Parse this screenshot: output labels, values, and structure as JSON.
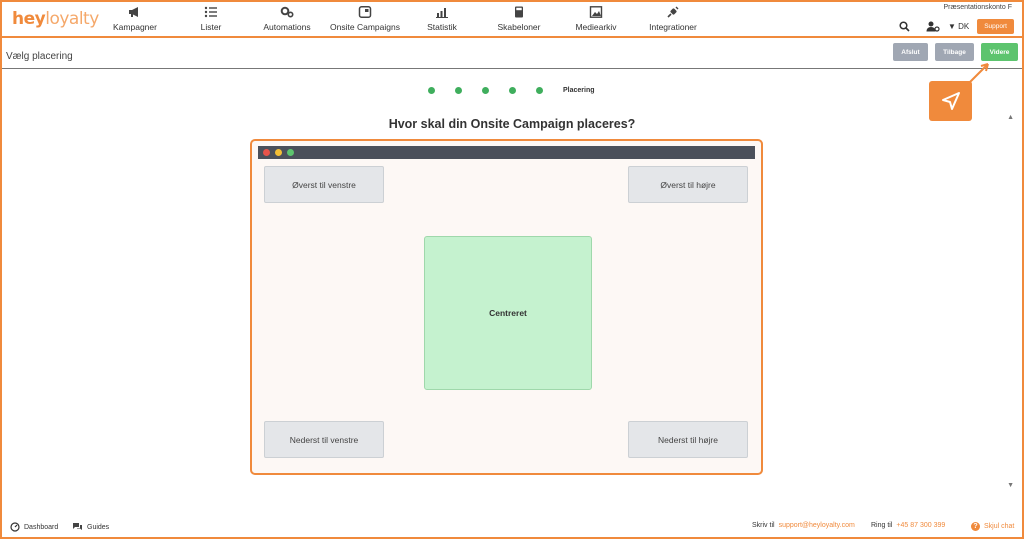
{
  "brand": {
    "logo_part1": "hey",
    "logo_part2": "loyalty"
  },
  "nav": {
    "items": [
      {
        "label": "Kampagner",
        "icon": "megaphone-icon"
      },
      {
        "label": "Lister",
        "icon": "list-icon"
      },
      {
        "label": "Automations",
        "icon": "gears-icon"
      },
      {
        "label": "Onsite Campaigns",
        "icon": "window-icon"
      },
      {
        "label": "Statistik",
        "icon": "chart-icon"
      },
      {
        "label": "Skabeloner",
        "icon": "calculator-icon"
      },
      {
        "label": "Mediearkiv",
        "icon": "image-icon"
      },
      {
        "label": "Integrationer",
        "icon": "plug-icon"
      }
    ],
    "account": "Præsentationskonto F",
    "language": "DK",
    "support_label": "Support"
  },
  "subheader": {
    "title": "Vælg placering",
    "cancel_label": "Afslut",
    "back_label": "Tilbage",
    "next_label": "Videre"
  },
  "wizard": {
    "steps_total": 5,
    "current_step_label": "Placering",
    "heading": "Hvor skal din Onsite Campaign placeres?"
  },
  "placement": {
    "top_left": "Øverst til venstre",
    "top_right": "Øverst til højre",
    "center": "Centreret",
    "bottom_left": "Nederst til venstre",
    "bottom_right": "Nederst til højre"
  },
  "footer": {
    "dashboard": "Dashboard",
    "guides": "Guides",
    "write_label": "Skriv til",
    "email": "support@heyloyalty.com",
    "call_label": "Ring til",
    "phone": "+45 87 300 399",
    "hide_chat": "Skjul chat"
  },
  "colors": {
    "accent": "#f08a3c",
    "success": "#5dc46e",
    "center_fill": "#c5f2cf",
    "step_dot": "#3fae5d"
  }
}
